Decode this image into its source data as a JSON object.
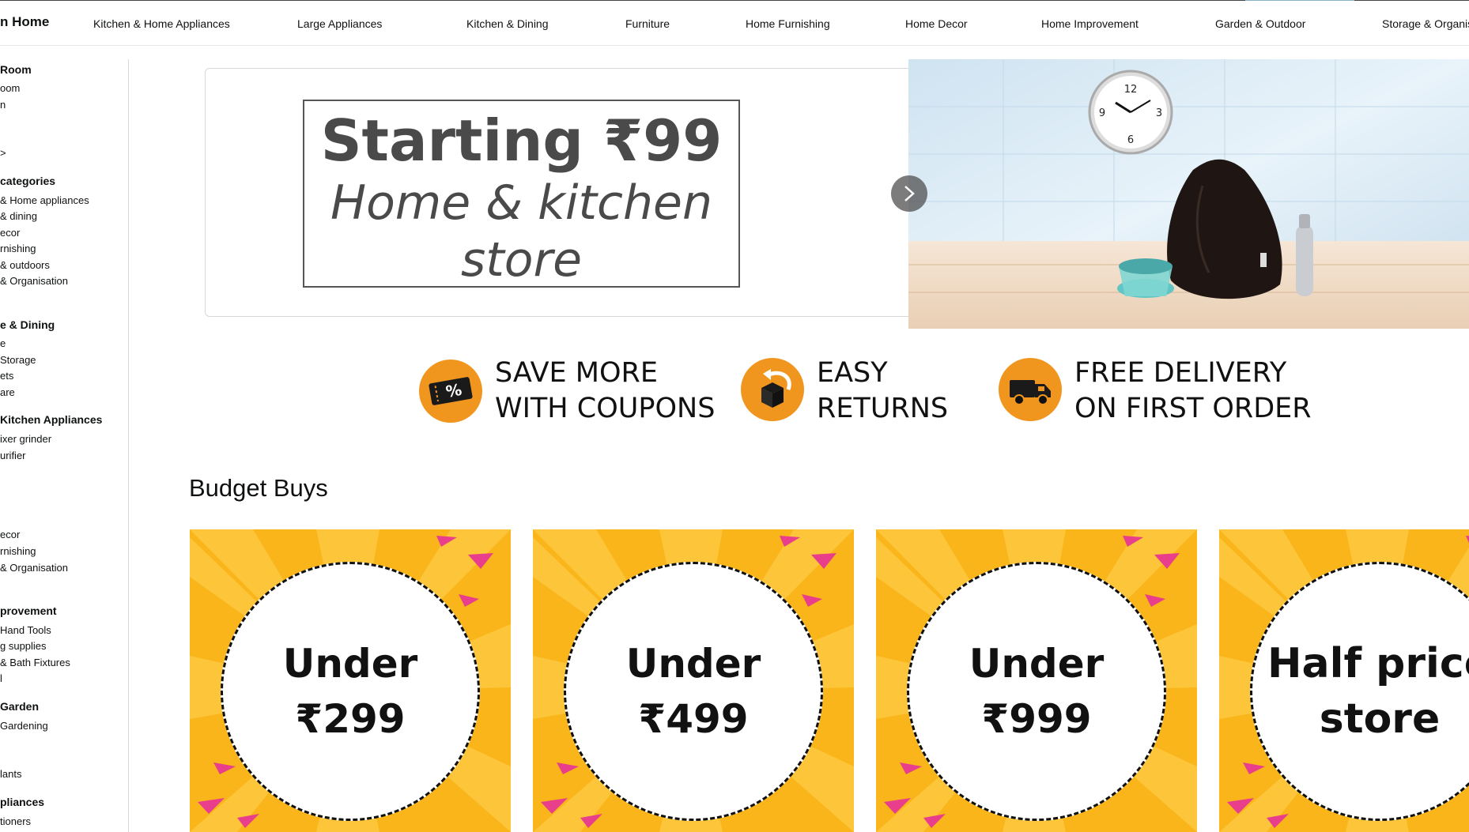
{
  "nav": {
    "brand": "n Home",
    "links": [
      "Kitchen & Home Appliances",
      "Large Appliances",
      "Kitchen & Dining",
      "Furniture",
      "Home Furnishing",
      "Home Decor",
      "Home Improvement",
      "Garden & Outdoor",
      "Storage & Organis"
    ]
  },
  "sidebar": [
    {
      "type": "h",
      "text": "Room"
    },
    {
      "type": "i",
      "text": "oom"
    },
    {
      "type": "i",
      "text": "n"
    },
    {
      "type": "i",
      "text": ">"
    },
    {
      "type": "h",
      "text": "categories"
    },
    {
      "type": "i",
      "text": "& Home appliances"
    },
    {
      "type": "i",
      "text": "& dining"
    },
    {
      "type": "i",
      "text": "ecor"
    },
    {
      "type": "i",
      "text": "rnishing"
    },
    {
      "type": "i",
      "text": "& outdoors"
    },
    {
      "type": "i",
      "text": "& Organisation"
    },
    {
      "type": "h",
      "text": "e & Dining"
    },
    {
      "type": "i",
      "text": "e"
    },
    {
      "type": "i",
      "text": "Storage"
    },
    {
      "type": "i",
      "text": "ets"
    },
    {
      "type": "i",
      "text": "are"
    },
    {
      "type": "h",
      "text": "Kitchen Appliances"
    },
    {
      "type": "i",
      "text": "ixer grinder"
    },
    {
      "type": "i",
      "text": "urifier"
    },
    {
      "type": "i",
      "text": "ecor"
    },
    {
      "type": "i",
      "text": "rnishing"
    },
    {
      "type": "i",
      "text": "& Organisation"
    },
    {
      "type": "h",
      "text": "provement"
    },
    {
      "type": "i",
      "text": "Hand Tools"
    },
    {
      "type": "i",
      "text": "g supplies"
    },
    {
      "type": "i",
      "text": "& Bath Fixtures"
    },
    {
      "type": "i",
      "text": "l"
    },
    {
      "type": "h",
      "text": "Garden"
    },
    {
      "type": "i",
      "text": "Gardening"
    },
    {
      "type": "i",
      "text": "lants"
    },
    {
      "type": "h",
      "text": "pliances"
    },
    {
      "type": "i",
      "text": "tioners"
    }
  ],
  "hero": {
    "title": "Starting ₹99",
    "subtitle_line1": "Home & kitchen",
    "subtitle_line2": "store"
  },
  "features": [
    {
      "line1": "SAVE MORE",
      "line2": "WITH COUPONS",
      "icon": "coupon-icon"
    },
    {
      "line1": "EASY",
      "line2": "RETURNS",
      "icon": "return-box-icon"
    },
    {
      "line1": "FREE DELIVERY",
      "line2": "ON FIRST ORDER",
      "icon": "delivery-truck-icon"
    }
  ],
  "budget": {
    "title": "Budget Buys",
    "cards": [
      "Under ₹299",
      "Under ₹499",
      "Under ₹999",
      "Half price store"
    ]
  },
  "colors": {
    "accent": "#f0961f",
    "card_bg": "#f9b51a",
    "card_rays": "#fdc53a",
    "confetti": "#e83e8c"
  }
}
